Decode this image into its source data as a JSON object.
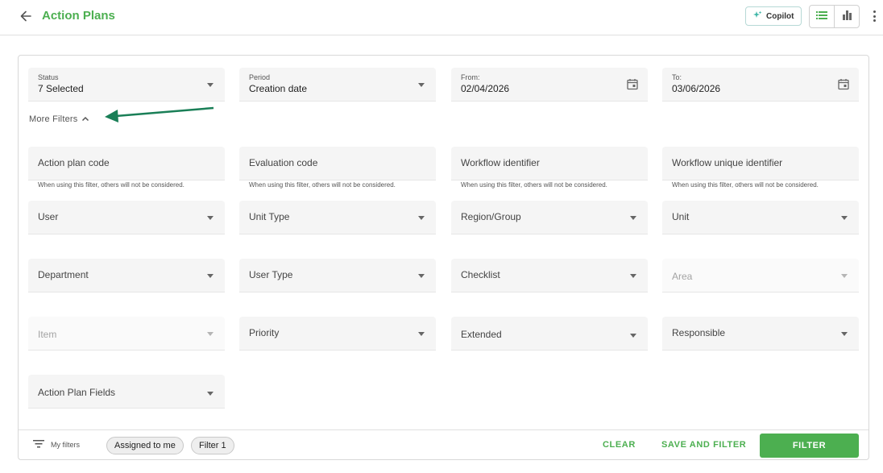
{
  "header": {
    "title": "Action Plans",
    "copilot_label": "Copilot",
    "accent_color": "#4caf50"
  },
  "filters": {
    "status": {
      "label": "Status",
      "value": "7 Selected"
    },
    "period": {
      "label": "Period",
      "value": "Creation date"
    },
    "from": {
      "label": "From:",
      "value": "02/04/2026"
    },
    "to": {
      "label": "To:",
      "value": "03/06/2026"
    }
  },
  "more_filters_label": "More Filters",
  "text_filters": [
    {
      "placeholder": "Action plan code",
      "hint": "When using this filter, others will not be considered."
    },
    {
      "placeholder": "Evaluation code",
      "hint": "When using this filter, others will not be considered."
    },
    {
      "placeholder": "Workflow identifier",
      "hint": "When using this filter, others will not be considered."
    },
    {
      "placeholder": "Workflow unique identifier",
      "hint": "When using this filter, others will not be considered."
    }
  ],
  "selects": {
    "user": "User",
    "unit_type": "Unit Type",
    "region_group": "Region/Group",
    "unit": "Unit",
    "department": "Department",
    "user_type": "User Type",
    "checklist": "Checklist",
    "area": "Area",
    "item": "Item",
    "priority": "Priority",
    "extended": "Extended",
    "responsible": "Responsible",
    "action_plan_fields": "Action Plan Fields"
  },
  "footer": {
    "my_filters": "My filters",
    "chips": [
      "Assigned to me",
      "Filter 1"
    ],
    "clear": "CLEAR",
    "save_and_filter": "SAVE AND FILTER",
    "filter": "FILTER"
  }
}
